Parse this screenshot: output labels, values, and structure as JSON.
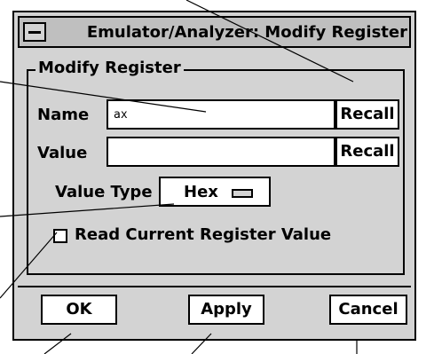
{
  "window": {
    "title": "Emulator/Analyzer: Modify Register"
  },
  "group": {
    "label": "Modify Register"
  },
  "name_field": {
    "label": "Name",
    "value": "ax",
    "recall_label": "Recall"
  },
  "value_field": {
    "label": "Value",
    "value": "",
    "recall_label": "Recall"
  },
  "value_type": {
    "label": "Value Type",
    "selected": "Hex"
  },
  "read_current": {
    "label": "Read Current Register Value",
    "checked": false
  },
  "buttons": {
    "ok": "OK",
    "apply": "Apply",
    "cancel": "Cancel"
  }
}
